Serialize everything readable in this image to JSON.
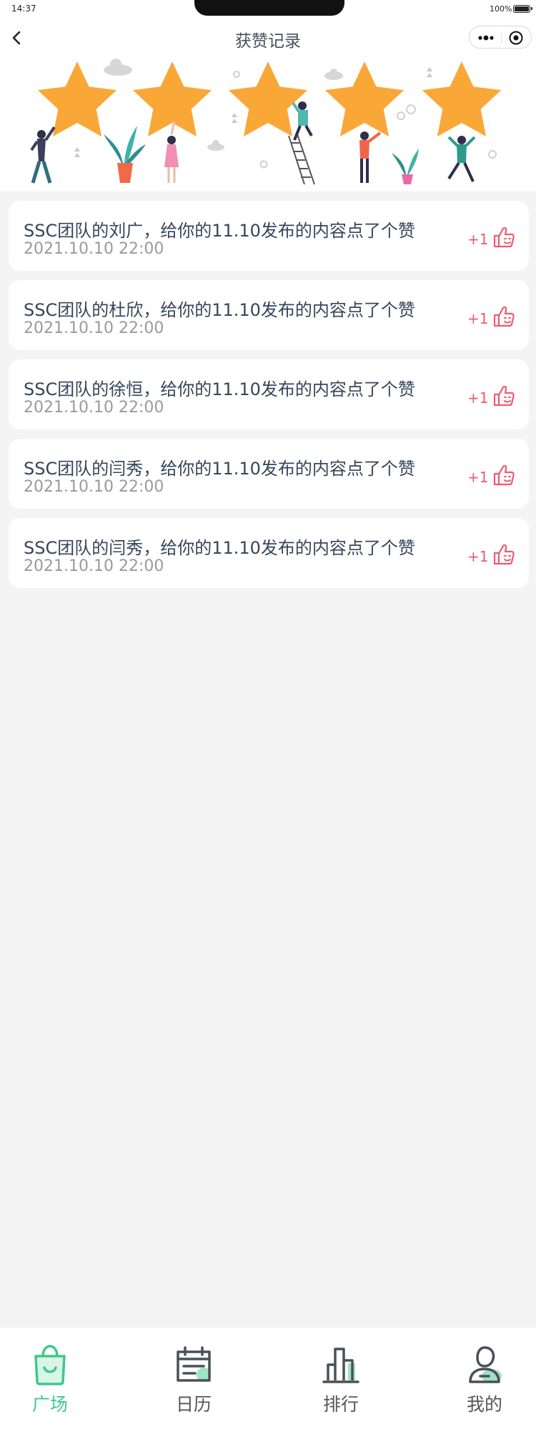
{
  "status_bar": {
    "time": "14:37",
    "battery": "100%"
  },
  "nav": {
    "title": "获赞记录"
  },
  "likes": [
    {
      "text": "SSC团队的刘广，给你的11.10发布的内容点了个赞",
      "time": "2021.10.10 22:00",
      "badge": "+1"
    },
    {
      "text": "SSC团队的杜欣，给你的11.10发布的内容点了个赞",
      "time": "2021.10.10 22:00",
      "badge": "+1"
    },
    {
      "text": "SSC团队的徐恒，给你的11.10发布的内容点了个赞",
      "time": "2021.10.10 22:00",
      "badge": "+1"
    },
    {
      "text": "SSC团队的闫秀，给你的11.10发布的内容点了个赞",
      "time": "2021.10.10 22:00",
      "badge": "+1"
    },
    {
      "text": "SSC团队的闫秀，给你的11.10发布的内容点了个赞",
      "time": "2021.10.10 22:00",
      "badge": "+1"
    }
  ],
  "tabs": [
    {
      "label": "广场",
      "icon": "shopping-bag-icon",
      "active": true
    },
    {
      "label": "日历",
      "icon": "calendar-icon",
      "active": false
    },
    {
      "label": "排行",
      "icon": "bar-chart-icon",
      "active": false
    },
    {
      "label": "我的",
      "icon": "user-icon",
      "active": false
    }
  ],
  "colors": {
    "accent": "#3fc88c",
    "like": "#f05a6e",
    "star": "#f9a838",
    "background": "#f4f4f4"
  }
}
